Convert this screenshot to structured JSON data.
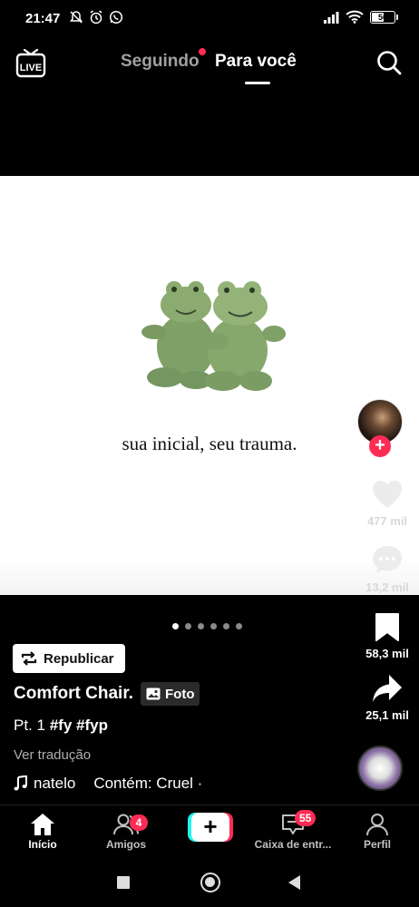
{
  "status_bar": {
    "time": "21:47",
    "battery": "56",
    "battery_level": 0.56
  },
  "top_nav": {
    "live_label": "LIVE",
    "tab_following": "Seguindo",
    "tab_for_you": "Para você",
    "following_has_new": true
  },
  "photo": {
    "caption": "sua inicial, seu trauma.",
    "page_count": 6,
    "active_page": 1
  },
  "post": {
    "repost_label": "Republicar",
    "author": "Comfort Chair.",
    "photo_tag": "Foto",
    "description_prefix": "Pt. 1",
    "hashtag_1": "#fy",
    "hashtag_2": "#fyp",
    "see_translation": "Ver tradução",
    "sound_name": "natelo",
    "sound_extra": "Contém: Cruel ·"
  },
  "actions": {
    "likes": "477 mil",
    "comments": "13,2 mil",
    "saves": "58,3 mil",
    "shares": "25,1 mil"
  },
  "bottom_nav": {
    "home": "Início",
    "friends": "Amigos",
    "friends_badge": "4",
    "create_symbol": "+",
    "inbox": "Caixa de entr...",
    "inbox_badge": "55",
    "profile": "Perfil"
  },
  "colors": {
    "accent": "#fe2c55",
    "cyan": "#25f4ee",
    "background": "#000000"
  },
  "icons": [
    "live-icon",
    "search-icon",
    "heart-icon",
    "comment-icon",
    "bookmark-icon",
    "share-icon",
    "music-note-icon",
    "home-icon",
    "friends-icon",
    "inbox-icon",
    "profile-icon",
    "repost-icon",
    "photo-icon"
  ]
}
